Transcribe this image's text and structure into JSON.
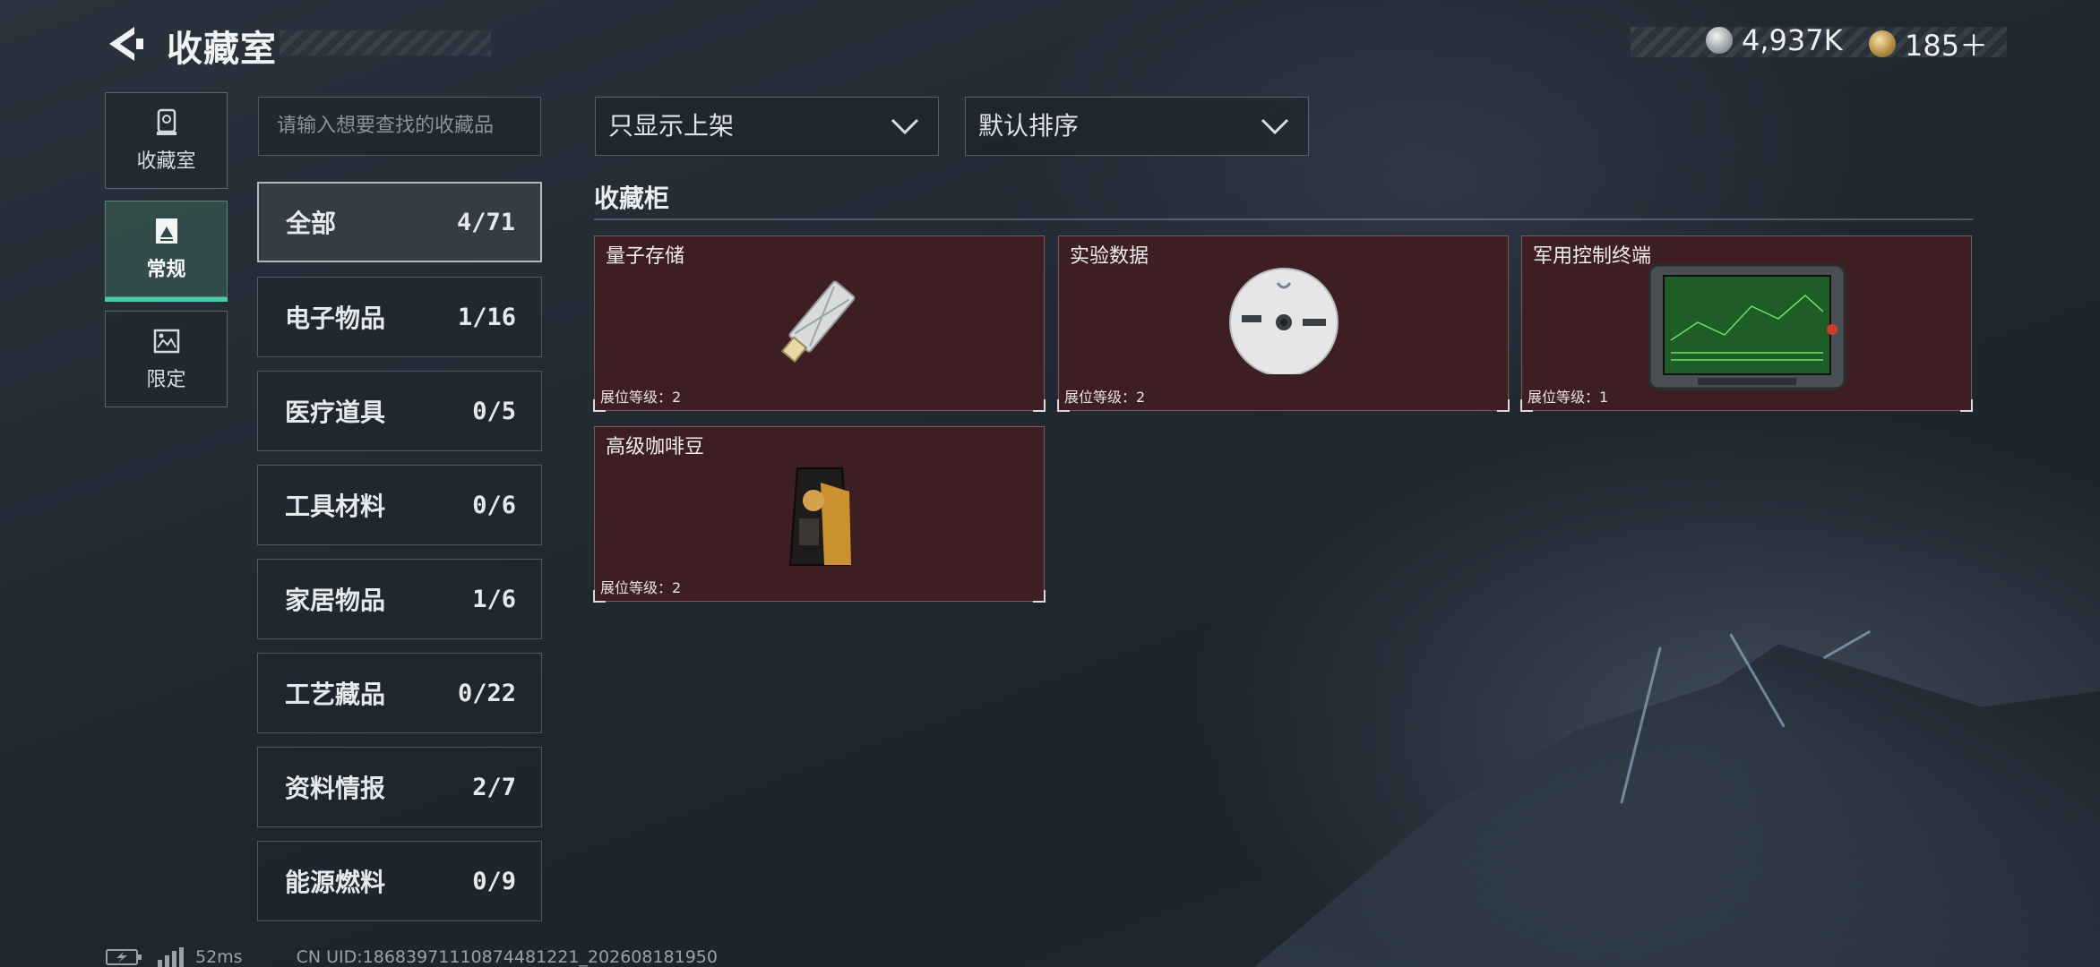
{
  "header": {
    "title": "收藏室",
    "currency_silver": "4,937K",
    "currency_gold": "185＋"
  },
  "nav": {
    "items": [
      {
        "label": "收藏室",
        "icon": "trophy-icon"
      },
      {
        "label": "常规",
        "icon": "frame-icon",
        "active": true
      },
      {
        "label": "限定",
        "icon": "picture-icon"
      }
    ]
  },
  "search": {
    "placeholder": "请输入想要查找的收藏品"
  },
  "filters": {
    "display": "只显示上架",
    "sort": "默认排序"
  },
  "categories": [
    {
      "label": "全部",
      "count": "4/71",
      "active": true
    },
    {
      "label": "电子物品",
      "count": "1/16"
    },
    {
      "label": "医疗道具",
      "count": "0/5"
    },
    {
      "label": "工具材料",
      "count": "0/6"
    },
    {
      "label": "家居物品",
      "count": "1/6"
    },
    {
      "label": "工艺藏品",
      "count": "0/22"
    },
    {
      "label": "资料情报",
      "count": "2/7"
    },
    {
      "label": "能源燃料",
      "count": "0/9"
    }
  ],
  "section": {
    "title": "收藏柜"
  },
  "items": [
    {
      "name": "量子存储",
      "level": "展位等级：2",
      "icon": "usb-drive-icon"
    },
    {
      "name": "实验数据",
      "level": "展位等级：2",
      "icon": "disc-icon"
    },
    {
      "name": "军用控制终端",
      "level": "展位等级：1",
      "icon": "terminal-icon"
    },
    {
      "name": "高级咖啡豆",
      "level": "展位等级：2",
      "icon": "coffee-bag-icon"
    }
  ],
  "footer": {
    "ping": "52ms",
    "uid": "CN UID:18683971110874481221_202608181950"
  },
  "colors": {
    "accent": "#3fd0a8",
    "card_bg": "#3d1f23"
  }
}
